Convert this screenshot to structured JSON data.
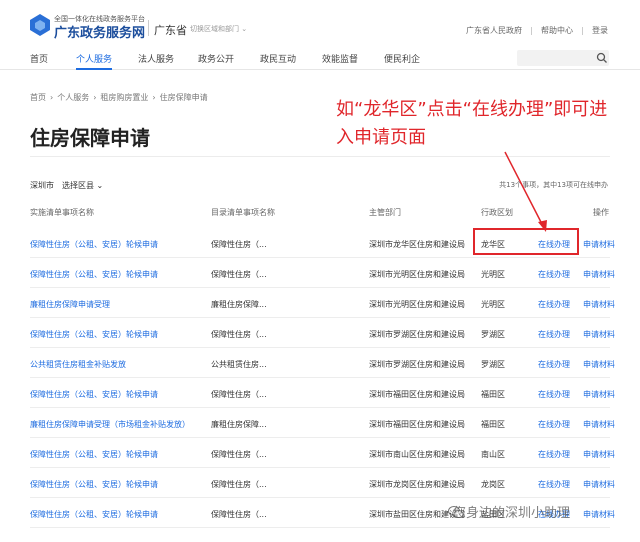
{
  "header": {
    "platform_line": "全国一体化在线政务服务平台",
    "brand": "广东政务服务网",
    "province": "广东省",
    "switch_link": "切换区域和部门 ⌄",
    "links": [
      "广东省人民政府",
      "帮助中心",
      "登录"
    ]
  },
  "nav": {
    "items": [
      "首页",
      "个人服务",
      "法人服务",
      "政务公开",
      "政民互动",
      "效能监督",
      "便民利企"
    ],
    "active_index": 1
  },
  "breadcrumb": [
    "首页",
    "个人服务",
    "租房购房置业",
    "住房保障申请"
  ],
  "page_title": "住房保障申请",
  "annotation": {
    "text": "如“龙华区”点击“在线办理”即可进入申请页面",
    "color": "#e0262b"
  },
  "filter": {
    "city": "深圳市",
    "region_select": "选择区县 ⌄"
  },
  "count_text": "共13个事项，其中13项可在线申办",
  "table": {
    "headers": [
      "实施清单事项名称",
      "目录清单事项名称",
      "主管部门",
      "行政区划",
      "操作"
    ],
    "rows": [
      {
        "name": "保障性住房（公租、安居）轮候申请",
        "catalog": "保障性住房（...",
        "dept": "深圳市龙华区住房和建设局",
        "district": "龙华区",
        "online": "在线办理",
        "material": "申请材料"
      },
      {
        "name": "保障性住房（公租、安居）轮候申请",
        "catalog": "保障性住房（...",
        "dept": "深圳市光明区住房和建设局",
        "district": "光明区",
        "online": "在线办理",
        "material": "申请材料"
      },
      {
        "name": "廉租住房保障申请受理",
        "catalog": "廉租住房保障...",
        "dept": "深圳市光明区住房和建设局",
        "district": "光明区",
        "online": "在线办理",
        "material": "申请材料"
      },
      {
        "name": "保障性住房（公租、安居）轮候申请",
        "catalog": "保障性住房（...",
        "dept": "深圳市罗湖区住房和建设局",
        "district": "罗湖区",
        "online": "在线办理",
        "material": "申请材料"
      },
      {
        "name": "公共租赁住房租金补贴发放",
        "catalog": "公共租赁住房...",
        "dept": "深圳市罗湖区住房和建设局",
        "district": "罗湖区",
        "online": "在线办理",
        "material": "申请材料"
      },
      {
        "name": "保障性住房（公租、安居）轮候申请",
        "catalog": "保障性住房（...",
        "dept": "深圳市福田区住房和建设局",
        "district": "福田区",
        "online": "在线办理",
        "material": "申请材料"
      },
      {
        "name": "廉租住房保障申请受理（市场租金补贴发放）",
        "catalog": "廉租住房保障...",
        "dept": "深圳市福田区住房和建设局",
        "district": "福田区",
        "online": "在线办理",
        "material": "申请材料"
      },
      {
        "name": "保障性住房（公租、安居）轮候申请",
        "catalog": "保障性住房（...",
        "dept": "深圳市南山区住房和建设局",
        "district": "南山区",
        "online": "在线办理",
        "material": "申请材料"
      },
      {
        "name": "保障性住房（公租、安居）轮候申请",
        "catalog": "保障性住房（...",
        "dept": "深圳市龙岗区住房和建设局",
        "district": "龙岗区",
        "online": "在线办理",
        "material": "申请材料"
      },
      {
        "name": "保障性住房（公租、安居）轮候申请",
        "catalog": "保障性住房（...",
        "dept": "深圳市盐田区住房和建设局",
        "district": "盐田区",
        "online": "在线办理",
        "material": "申请材料"
      }
    ]
  },
  "watermark": "您身边的深圳小助理",
  "colors": {
    "accent": "#1e6ce0",
    "brand": "#1b4d9c",
    "annotation": "#e0262b"
  }
}
